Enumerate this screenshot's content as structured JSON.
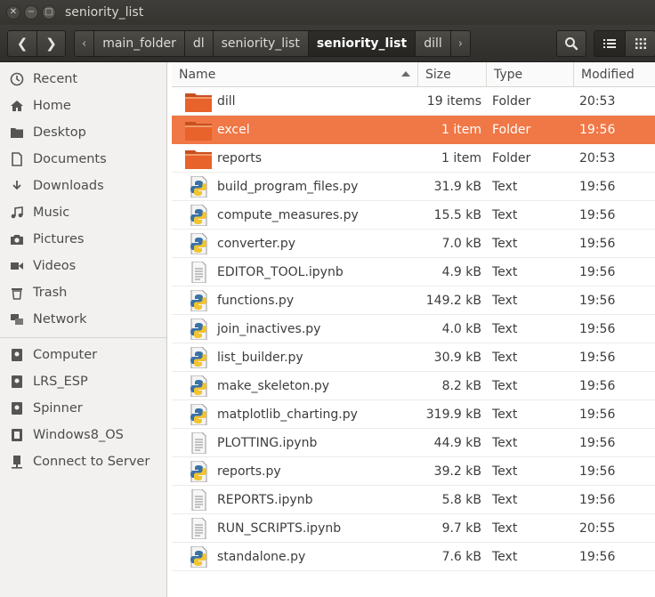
{
  "window": {
    "title": "seniority_list",
    "close_glyph": "✕",
    "minimize_glyph": "−",
    "maximize_glyph": "□"
  },
  "toolbar": {
    "back_glyph": "❮",
    "forward_glyph": "❯",
    "breadcrumb_left_glyph": "‹",
    "breadcrumb_right_glyph": "›",
    "breadcrumbs": [
      "main_folder",
      "dl",
      "seniority_list",
      "seniority_list",
      "dill"
    ],
    "active_crumb_index": 3
  },
  "sidebar": {
    "items": [
      {
        "label": "Recent",
        "icon": "clock-icon"
      },
      {
        "label": "Home",
        "icon": "home-icon"
      },
      {
        "label": "Desktop",
        "icon": "desktop-folder-icon"
      },
      {
        "label": "Documents",
        "icon": "document-icon"
      },
      {
        "label": "Downloads",
        "icon": "download-icon"
      },
      {
        "label": "Music",
        "icon": "music-icon"
      },
      {
        "label": "Pictures",
        "icon": "camera-icon"
      },
      {
        "label": "Videos",
        "icon": "video-icon"
      },
      {
        "label": "Trash",
        "icon": "trash-icon"
      },
      {
        "label": "Network",
        "icon": "network-icon"
      }
    ],
    "devices": [
      {
        "label": "Computer",
        "icon": "drive-icon"
      },
      {
        "label": "LRS_ESP",
        "icon": "drive-icon"
      },
      {
        "label": "Spinner",
        "icon": "drive-icon"
      },
      {
        "label": "Windows8_OS",
        "icon": "drive-icon"
      },
      {
        "label": "Connect to Server",
        "icon": "server-icon"
      }
    ]
  },
  "list": {
    "columns": {
      "name": "Name",
      "size": "Size",
      "type": "Type",
      "modified": "Modified"
    },
    "rows": [
      {
        "name": "dill",
        "size": "19 items",
        "type": "Folder",
        "modified": "20:53",
        "icon": "folder-icon"
      },
      {
        "name": "excel",
        "size": "1 item",
        "type": "Folder",
        "modified": "19:56",
        "icon": "folder-icon"
      },
      {
        "name": "reports",
        "size": "1 item",
        "type": "Folder",
        "modified": "20:53",
        "icon": "folder-icon"
      },
      {
        "name": "build_program_files.py",
        "size": "31.9 kB",
        "type": "Text",
        "modified": "19:56",
        "icon": "python-file-icon"
      },
      {
        "name": "compute_measures.py",
        "size": "15.5 kB",
        "type": "Text",
        "modified": "19:56",
        "icon": "python-file-icon"
      },
      {
        "name": "converter.py",
        "size": "7.0 kB",
        "type": "Text",
        "modified": "19:56",
        "icon": "python-file-icon"
      },
      {
        "name": "EDITOR_TOOL.ipynb",
        "size": "4.9 kB",
        "type": "Text",
        "modified": "19:56",
        "icon": "text-file-icon"
      },
      {
        "name": "functions.py",
        "size": "149.2 kB",
        "type": "Text",
        "modified": "19:56",
        "icon": "python-file-icon"
      },
      {
        "name": "join_inactives.py",
        "size": "4.0 kB",
        "type": "Text",
        "modified": "19:56",
        "icon": "python-file-icon"
      },
      {
        "name": "list_builder.py",
        "size": "30.9 kB",
        "type": "Text",
        "modified": "19:56",
        "icon": "python-file-icon"
      },
      {
        "name": "make_skeleton.py",
        "size": "8.2 kB",
        "type": "Text",
        "modified": "19:56",
        "icon": "python-file-icon"
      },
      {
        "name": "matplotlib_charting.py",
        "size": "319.9 kB",
        "type": "Text",
        "modified": "19:56",
        "icon": "python-file-icon"
      },
      {
        "name": "PLOTTING.ipynb",
        "size": "44.9 kB",
        "type": "Text",
        "modified": "19:56",
        "icon": "text-file-icon"
      },
      {
        "name": "reports.py",
        "size": "39.2 kB",
        "type": "Text",
        "modified": "19:56",
        "icon": "python-file-icon"
      },
      {
        "name": "REPORTS.ipynb",
        "size": "5.8 kB",
        "type": "Text",
        "modified": "19:56",
        "icon": "text-file-icon"
      },
      {
        "name": "RUN_SCRIPTS.ipynb",
        "size": "9.7 kB",
        "type": "Text",
        "modified": "20:55",
        "icon": "text-file-icon"
      },
      {
        "name": "standalone.py",
        "size": "7.6 kB",
        "type": "Text",
        "modified": "19:56",
        "icon": "python-file-icon"
      }
    ],
    "selected_index": 1
  },
  "colors": {
    "selection": "#f07746",
    "folder": "#e8622b",
    "titlebar": "#3c3b37",
    "sidebar_bg": "#f2f1f0"
  }
}
